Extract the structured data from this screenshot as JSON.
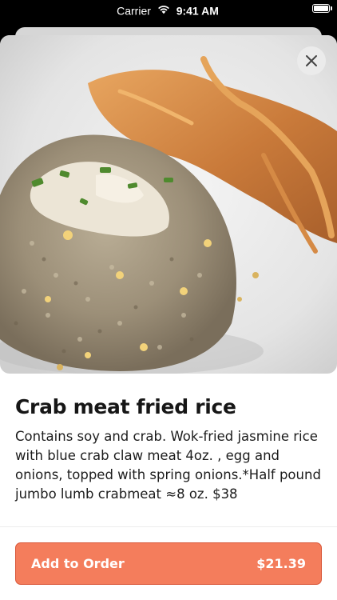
{
  "status_bar": {
    "carrier": "Carrier",
    "time": "9:41 AM"
  },
  "item": {
    "name": "Crab meat fried rice",
    "description": "Contains soy and crab. Wok-fried jasmine rice with blue crab claw meat 4oz. , egg and onions, topped with spring onions.*Half pound jumbo lumb crabmeat ≈8 oz.  $38"
  },
  "order_button": {
    "label": "Add to Order",
    "price": "$21.39"
  },
  "colors": {
    "accent": "#f47d5c",
    "accent_border": "#d9583a",
    "sheet_background": "#ffffff",
    "screen_background": "#000000"
  },
  "icons": {
    "close": "close-icon",
    "wifi": "wifi-icon",
    "battery": "battery-icon"
  }
}
